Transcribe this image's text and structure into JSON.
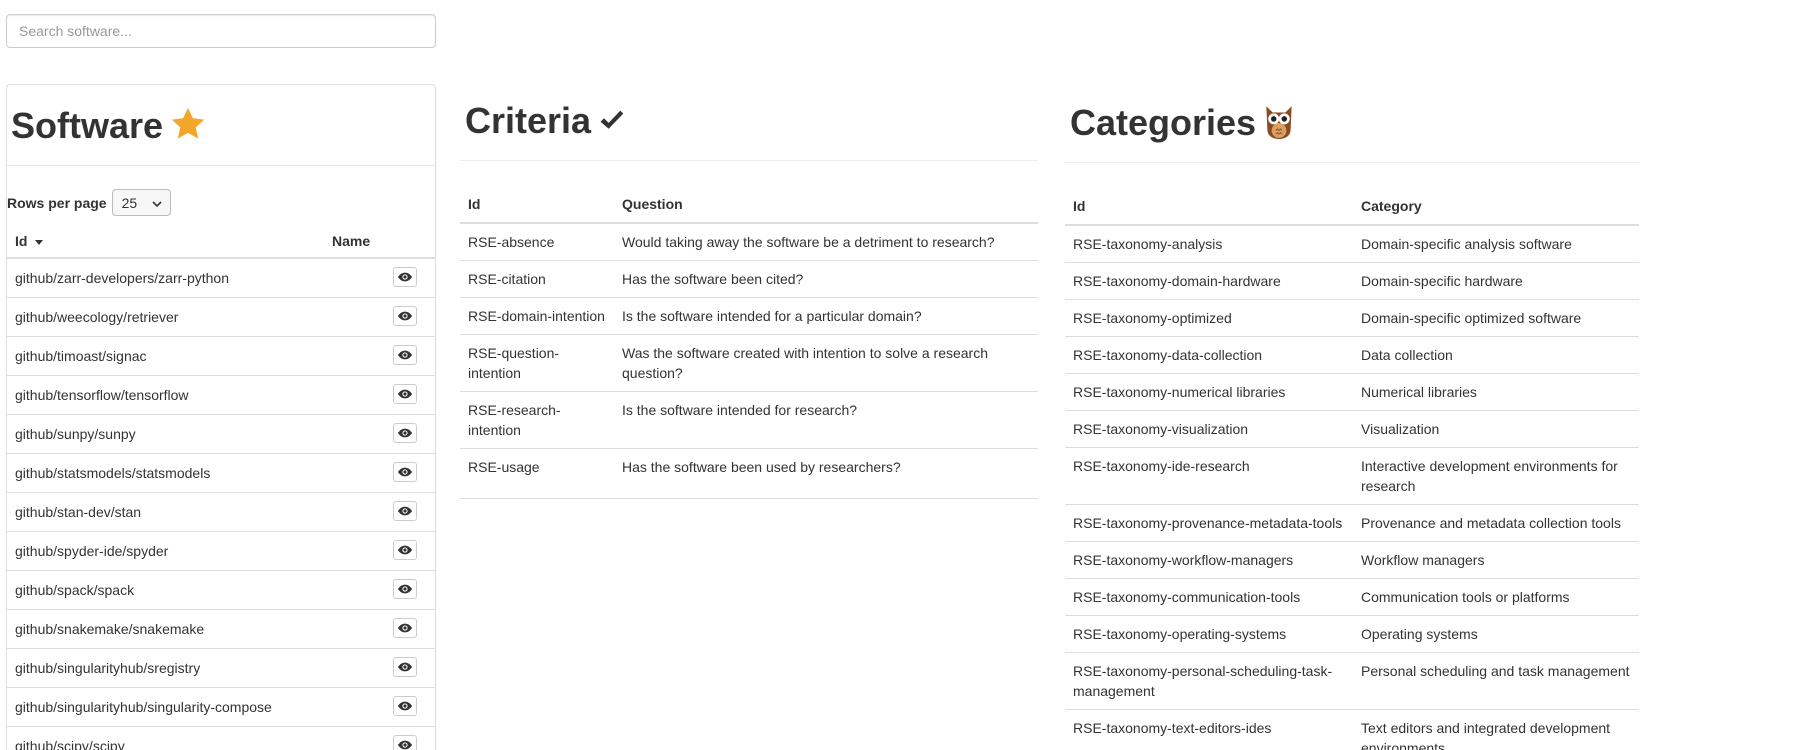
{
  "search": {
    "placeholder": "Search software..."
  },
  "software": {
    "title": "Software",
    "title_icon": "star-icon",
    "rows_per_page_label": "Rows per page",
    "rows_per_page_value": "25",
    "columns": {
      "id": "Id",
      "name": "Name"
    },
    "rows": [
      {
        "id": "github/zarr-developers/zarr-python"
      },
      {
        "id": "github/weecology/retriever"
      },
      {
        "id": "github/timoast/signac"
      },
      {
        "id": "github/tensorflow/tensorflow"
      },
      {
        "id": "github/sunpy/sunpy"
      },
      {
        "id": "github/statsmodels/statsmodels"
      },
      {
        "id": "github/stan-dev/stan"
      },
      {
        "id": "github/spyder-ide/spyder"
      },
      {
        "id": "github/spack/spack"
      },
      {
        "id": "github/snakemake/snakemake"
      },
      {
        "id": "github/singularityhub/sregistry"
      },
      {
        "id": "github/singularityhub/singularity-compose"
      },
      {
        "id": "github/scipy/scipy"
      }
    ]
  },
  "criteria": {
    "title": "Criteria",
    "title_icon": "heavy-check-icon",
    "columns": {
      "id": "Id",
      "question": "Question"
    },
    "rows": [
      {
        "id": "RSE-absence",
        "question": "Would taking away the software be a detriment to research?"
      },
      {
        "id": "RSE-citation",
        "question": "Has the software been cited?"
      },
      {
        "id": "RSE-domain-intention",
        "question": "Is the software intended for a particular domain?"
      },
      {
        "id": "RSE-question-intention",
        "question": "Was the software created with intention to solve a research question?"
      },
      {
        "id": "RSE-research-intention",
        "question": "Is the software intended for research?"
      },
      {
        "id": "RSE-usage",
        "question": "Has the software been used by researchers?"
      }
    ]
  },
  "categories": {
    "title": "Categories",
    "title_icon": "owl-icon",
    "columns": {
      "id": "Id",
      "category": "Category"
    },
    "rows": [
      {
        "id": "RSE-taxonomy-analysis",
        "category": "Domain-specific analysis software"
      },
      {
        "id": "RSE-taxonomy-domain-hardware",
        "category": "Domain-specific hardware"
      },
      {
        "id": "RSE-taxonomy-optimized",
        "category": "Domain-specific optimized software"
      },
      {
        "id": "RSE-taxonomy-data-collection",
        "category": "Data collection"
      },
      {
        "id": "RSE-taxonomy-numerical libraries",
        "category": "Numerical libraries"
      },
      {
        "id": "RSE-taxonomy-visualization",
        "category": "Visualization"
      },
      {
        "id": "RSE-taxonomy-ide-research",
        "category": "Interactive development environments for research"
      },
      {
        "id": "RSE-taxonomy-provenance-metadata-tools",
        "category": "Provenance and metadata collection tools"
      },
      {
        "id": "RSE-taxonomy-workflow-managers",
        "category": "Workflow managers"
      },
      {
        "id": "RSE-taxonomy-communication-tools",
        "category": "Communication tools or platforms"
      },
      {
        "id": "RSE-taxonomy-operating-systems",
        "category": "Operating systems"
      },
      {
        "id": "RSE-taxonomy-personal-scheduling-task-management",
        "category": "Personal scheduling and task management"
      },
      {
        "id": "RSE-taxonomy-text-editors-ides",
        "category": "Text editors and integrated development environments"
      }
    ]
  },
  "colors": {
    "star": "#f4a62a",
    "text": "#333333",
    "border": "#dddddd"
  }
}
